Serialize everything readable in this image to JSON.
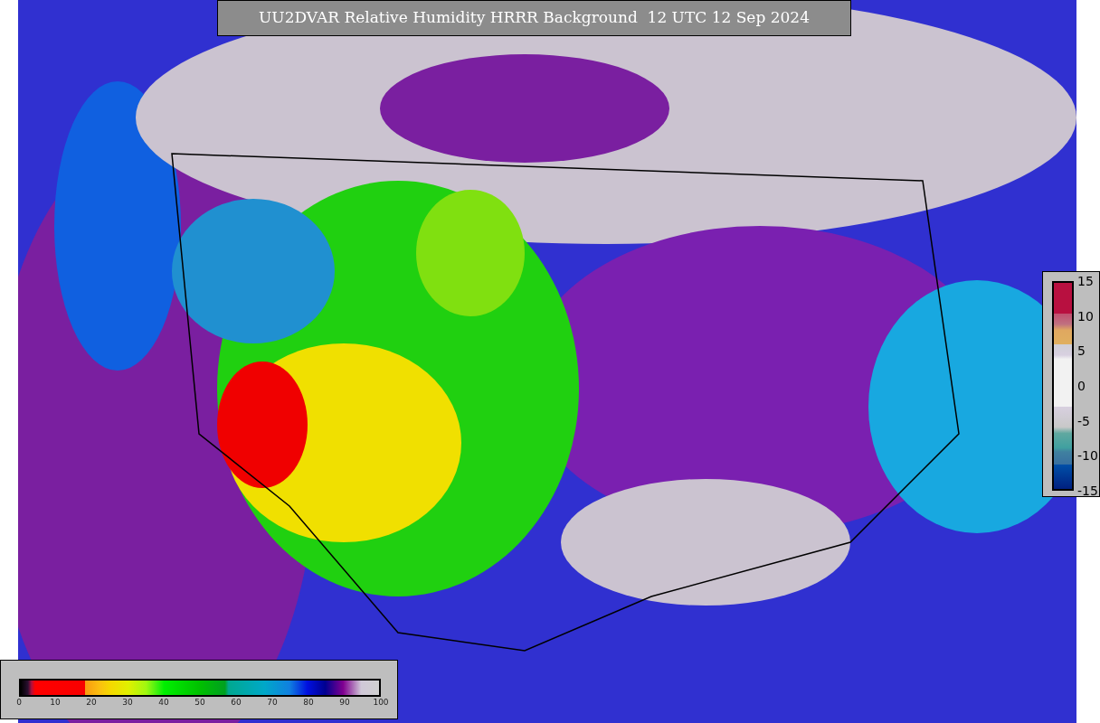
{
  "title": "UU2DVAR Relative Humidity HRRR Background  12 UTC 12 Sep 2024",
  "humidity_colorbar": {
    "ticks": [
      "0",
      "10",
      "20",
      "30",
      "40",
      "50",
      "60",
      "70",
      "80",
      "90",
      "100"
    ]
  },
  "difference_colorbar": {
    "ticks": [
      "15",
      "10",
      "5",
      "0",
      "-5",
      "-10",
      "-15"
    ]
  }
}
